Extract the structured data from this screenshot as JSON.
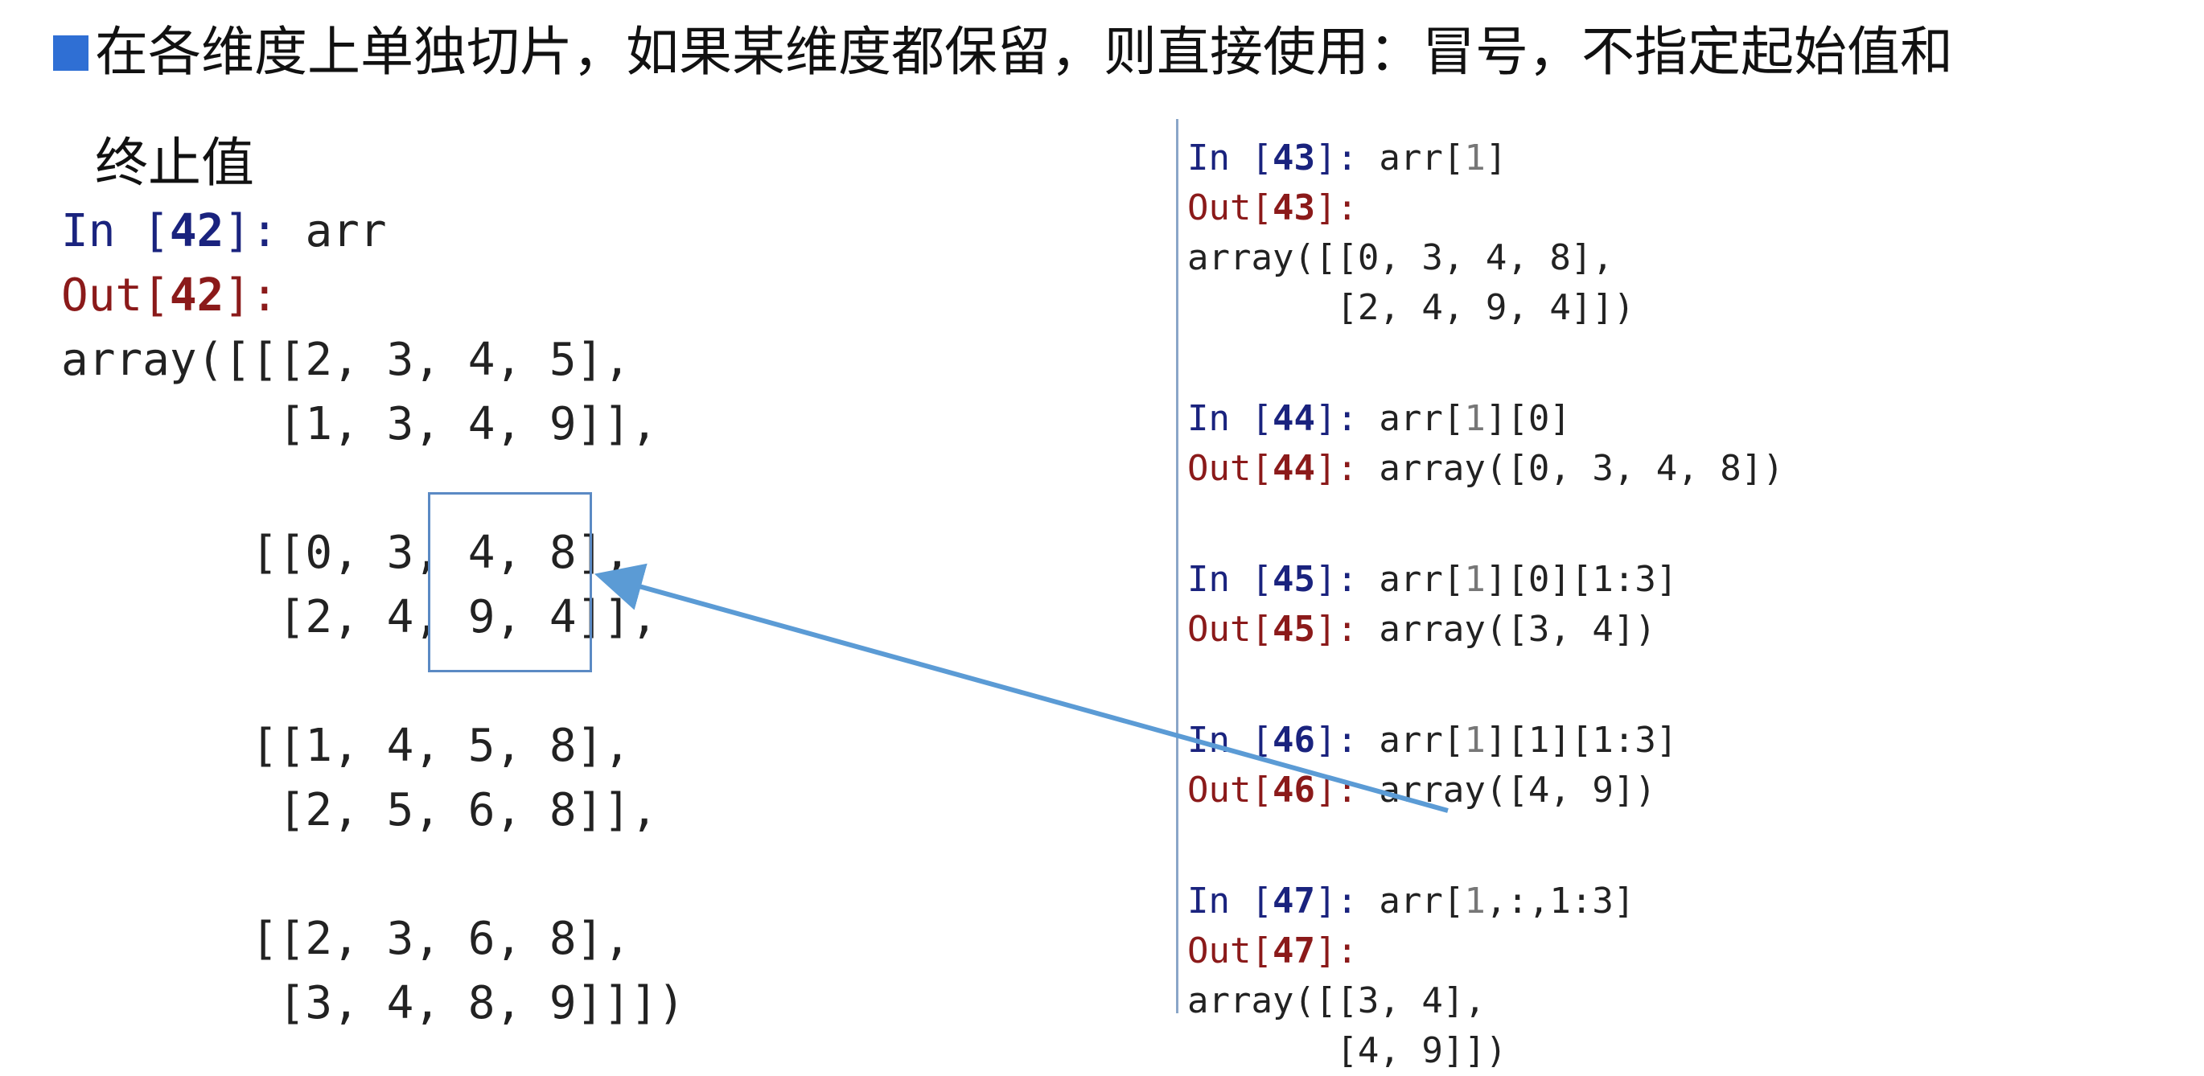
{
  "title": {
    "line1": "在各维度上单独切片，如果某维度都保留，则直接使用：冒号，不指定起始值和",
    "line2": "终止值"
  },
  "left_panel": {
    "in_label": "In [",
    "in_num": "42",
    "in_close": "]:",
    "in_cmd": " arr",
    "out_label": "Out[",
    "out_num": "42",
    "out_close": "]:",
    "lines": [
      "array([[[2, 3, 4, 5],",
      "        [1, 3, 4, 9]],",
      "",
      "       [[0, 3, 4, 8],",
      "        [2, 4, 9, 4]],",
      "",
      "       [[1, 4, 5, 8],",
      "        [2, 5, 6, 8]],",
      "",
      "       [[2, 3, 6, 8],",
      "        [3, 4, 8, 9]]])"
    ]
  },
  "right_panel": {
    "cells": [
      {
        "in_num": "43",
        "cmd_pre": " arr[",
        "cmd_dim": "1",
        "cmd_post": "]",
        "out_num": "43",
        "out_inline": "",
        "result": [
          "array([[0, 3, 4, 8],",
          "       [2, 4, 9, 4]])"
        ]
      },
      {
        "in_num": "44",
        "cmd_pre": " arr[",
        "cmd_dim": "1",
        "cmd_post": "][0]",
        "out_num": "44",
        "out_inline": " array([0, 3, 4, 8])",
        "result": []
      },
      {
        "in_num": "45",
        "cmd_pre": " arr[",
        "cmd_dim": "1",
        "cmd_post": "][0][1:3]",
        "out_num": "45",
        "out_inline": " array([3, 4])",
        "result": []
      },
      {
        "in_num": "46",
        "cmd_pre": " arr[",
        "cmd_dim": "1",
        "cmd_post": "][1][1:3]",
        "out_num": "46",
        "out_inline": " array([4, 9])",
        "result": []
      },
      {
        "in_num": "47",
        "cmd_pre": " arr[",
        "cmd_dim": "1",
        "cmd_post": ",:,1:3]",
        "out_num": "47",
        "out_inline": "",
        "result": [
          "array([[3, 4],",
          "       [4, 9]])"
        ]
      }
    ]
  },
  "colors": {
    "bullet": "#2f6fd4",
    "arrow": "#5b9bd5",
    "highlight_box": "#5b8ac4",
    "divider": "#8aa6c8",
    "in_prompt": "#1a237e",
    "out_prompt": "#8b1a1a"
  }
}
